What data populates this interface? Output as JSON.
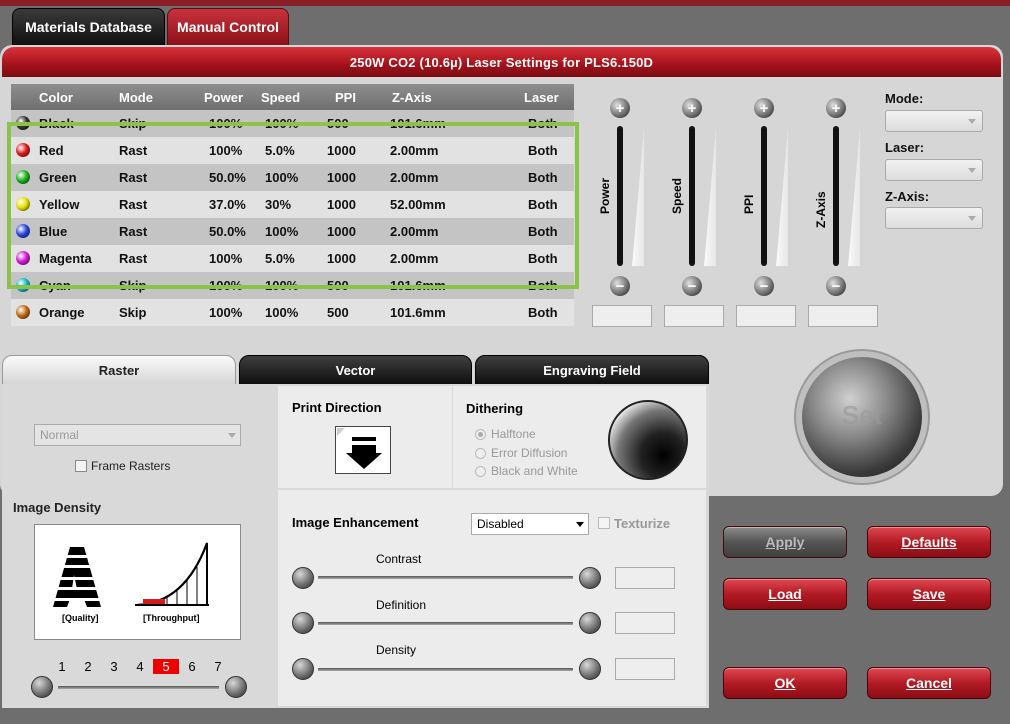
{
  "tabs": [
    {
      "label": "Materials Database"
    },
    {
      "label": "Manual Control"
    }
  ],
  "header_title": "250W CO2 (10.6µ) Laser Settings for PLS6.150D",
  "table": {
    "columns": [
      "Color",
      "Mode",
      "Power",
      "Speed",
      "PPI",
      "Z-Axis",
      "Laser"
    ],
    "rows": [
      {
        "color": "Black",
        "mode": "Skip",
        "power": "100%",
        "speed": "100%",
        "ppi": "500",
        "zaxis": "101.6mm",
        "laser": "Both",
        "hex": "#333333"
      },
      {
        "color": "Red",
        "mode": "Rast",
        "power": "100%",
        "speed": "5.0%",
        "ppi": "1000",
        "zaxis": "2.00mm",
        "laser": "Both",
        "hex": "#e01a1a"
      },
      {
        "color": "Green",
        "mode": "Rast",
        "power": "50.0%",
        "speed": "100%",
        "ppi": "1000",
        "zaxis": "2.00mm",
        "laser": "Both",
        "hex": "#1bb31b"
      },
      {
        "color": "Yellow",
        "mode": "Rast",
        "power": "37.0%",
        "speed": "30%",
        "ppi": "1000",
        "zaxis": "52.00mm",
        "laser": "Both",
        "hex": "#e8e000"
      },
      {
        "color": "Blue",
        "mode": "Rast",
        "power": "50.0%",
        "speed": "100%",
        "ppi": "1000",
        "zaxis": "2.00mm",
        "laser": "Both",
        "hex": "#2a48e0"
      },
      {
        "color": "Magenta",
        "mode": "Rast",
        "power": "100%",
        "speed": "5.0%",
        "ppi": "1000",
        "zaxis": "2.00mm",
        "laser": "Both",
        "hex": "#d41ad4"
      },
      {
        "color": "Cyan",
        "mode": "Skip",
        "power": "100%",
        "speed": "100%",
        "ppi": "500",
        "zaxis": "101.6mm",
        "laser": "Both",
        "hex": "#16b8c8"
      },
      {
        "color": "Orange",
        "mode": "Skip",
        "power": "100%",
        "speed": "100%",
        "ppi": "500",
        "zaxis": "101.6mm",
        "laser": "Both",
        "hex": "#c06a10"
      }
    ]
  },
  "sliders": [
    {
      "label": "Power"
    },
    {
      "label": "Speed"
    },
    {
      "label": "PPI"
    },
    {
      "label": "Z-Axis"
    }
  ],
  "right_fields": {
    "mode": "Mode:",
    "laser": "Laser:",
    "zaxis": "Z-Axis:"
  },
  "set_label": "Set",
  "bottom_tabs": [
    {
      "label": "Raster"
    },
    {
      "label": "Vector"
    },
    {
      "label": "Engraving Field"
    }
  ],
  "raster": {
    "mode_value": "Normal",
    "frame_rasters": "Frame Rasters",
    "image_density": "Image Density",
    "quality": "[Quality]",
    "throughput": "[Throughput]",
    "density_numbers": [
      "1",
      "2",
      "3",
      "4",
      "5",
      "6",
      "7"
    ],
    "density_selected": "5"
  },
  "print_direction": "Print Direction",
  "dithering": {
    "title": "Dithering",
    "options": [
      "Halftone",
      "Error Diffusion",
      "Black and White"
    ]
  },
  "enhancement": {
    "title": "Image Enhancement",
    "value": "Disabled",
    "texturize": "Texturize",
    "contrast": "Contrast",
    "definition": "Definition",
    "density": "Density"
  },
  "buttons": {
    "apply": "Apply",
    "defaults": "Defaults",
    "load": "Load",
    "save": "Save",
    "ok": "OK",
    "cancel": "Cancel"
  },
  "accent_red": "#b21b24",
  "highlight_green": "#8bc34a"
}
